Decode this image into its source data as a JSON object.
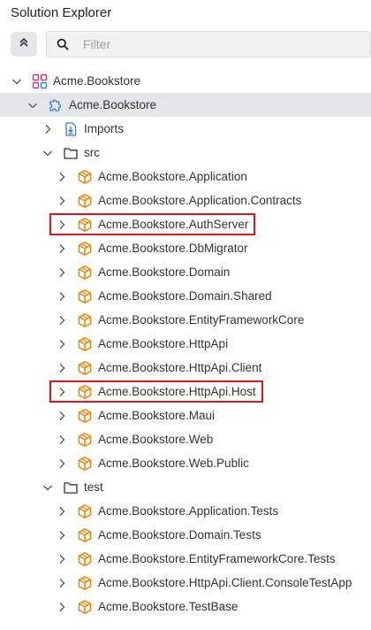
{
  "header": {
    "title": "Solution Explorer"
  },
  "toolbar": {
    "collapse_all_icon": "double-chevron-up-icon"
  },
  "filter": {
    "placeholder": "Filter",
    "icon": "search-icon"
  },
  "tree": {
    "solution": "Acme.Bookstore",
    "project": "Acme.Bookstore",
    "imports": "Imports",
    "src_folder": "src",
    "src_items": [
      "Acme.Bookstore.Application",
      "Acme.Bookstore.Application.Contracts",
      "Acme.Bookstore.AuthServer",
      "Acme.Bookstore.DbMigrator",
      "Acme.Bookstore.Domain",
      "Acme.Bookstore.Domain.Shared",
      "Acme.Bookstore.EntityFrameworkCore",
      "Acme.Bookstore.HttpApi",
      "Acme.Bookstore.HttpApi.Client",
      "Acme.Bookstore.HttpApi.Host",
      "Acme.Bookstore.Maui",
      "Acme.Bookstore.Web",
      "Acme.Bookstore.Web.Public"
    ],
    "test_folder": "test",
    "test_items": [
      "Acme.Bookstore.Application.Tests",
      "Acme.Bookstore.Domain.Tests",
      "Acme.Bookstore.EntityFrameworkCore.Tests",
      "Acme.Bookstore.HttpApi.Client.ConsoleTestApp",
      "Acme.Bookstore.TestBase"
    ],
    "highlighted": [
      "Acme.Bookstore.AuthServer",
      "Acme.Bookstore.HttpApi.Host"
    ]
  },
  "colors": {
    "package_icon": "#e8891a",
    "solution_icon": "#d6336c",
    "project_icon": "#3b7ddd",
    "highlight_border": "#e0141b",
    "selected_row": "#e5e6e9"
  }
}
